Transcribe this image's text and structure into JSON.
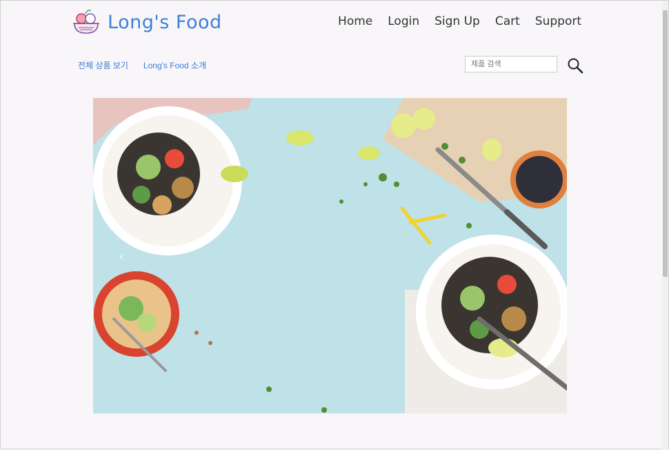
{
  "brand": {
    "name": "Long's Food",
    "color": "#3d7fd6"
  },
  "nav": {
    "items": [
      "Home",
      "Login",
      "Sign Up",
      "Cart",
      "Support"
    ]
  },
  "subnav": {
    "items": [
      "전체 상품 보기",
      "Long's Food 소개"
    ]
  },
  "search": {
    "placeholder": "제품 검색"
  },
  "carousel": {
    "prev_glyph": "‹"
  }
}
